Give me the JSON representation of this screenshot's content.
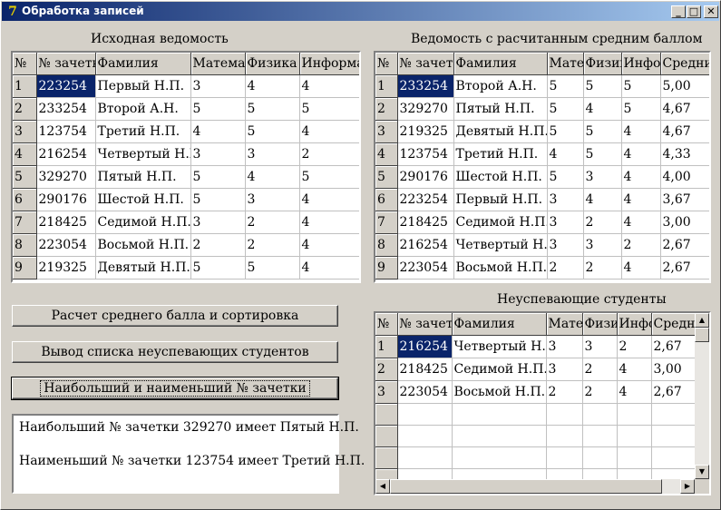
{
  "window": {
    "title": "Обработка записей",
    "minimize_glyph": "_",
    "maximize_glyph": "□",
    "close_glyph": "✕"
  },
  "left_grid": {
    "caption": "Исходная ведомость",
    "columns": [
      "№",
      "№ зачетки",
      "Фамилия",
      "Математика",
      "Физика",
      "Информатика"
    ],
    "rows": [
      [
        "1",
        "223254",
        "Первый Н.П.",
        "3",
        "4",
        "4"
      ],
      [
        "2",
        "233254",
        "Второй А.Н.",
        "5",
        "5",
        "5"
      ],
      [
        "3",
        "123754",
        "Третий Н.П.",
        "4",
        "5",
        "4"
      ],
      [
        "4",
        "216254",
        "Четвертый Н.П.",
        "3",
        "3",
        "2"
      ],
      [
        "5",
        "329270",
        "Пятый Н.П.",
        "5",
        "4",
        "5"
      ],
      [
        "6",
        "290176",
        "Шестой Н.П.",
        "5",
        "3",
        "4"
      ],
      [
        "7",
        "218425",
        "Седимой Н.П.",
        "3",
        "2",
        "4"
      ],
      [
        "8",
        "223054",
        "Восьмой Н.П.",
        "2",
        "2",
        "4"
      ],
      [
        "9",
        "219325",
        "Девятый Н.П.",
        "5",
        "5",
        "4"
      ]
    ]
  },
  "right_grid": {
    "caption": "Ведомость с расчитанным средним баллом",
    "columns": [
      "№",
      "№ зачетки",
      "Фамилия",
      "Математика",
      "Физика",
      "Информатика",
      "Средний балл"
    ],
    "rows": [
      [
        "1",
        "233254",
        "Второй А.Н.",
        "5",
        "5",
        "5",
        "5,00"
      ],
      [
        "2",
        "329270",
        "Пятый Н.П.",
        "5",
        "4",
        "5",
        "4,67"
      ],
      [
        "3",
        "219325",
        "Девятый Н.П.",
        "5",
        "5",
        "4",
        "4,67"
      ],
      [
        "4",
        "123754",
        "Третий Н.П.",
        "4",
        "5",
        "4",
        "4,33"
      ],
      [
        "5",
        "290176",
        "Шестой Н.П.",
        "5",
        "3",
        "4",
        "4,00"
      ],
      [
        "6",
        "223254",
        "Первый Н.П.",
        "3",
        "4",
        "4",
        "3,67"
      ],
      [
        "7",
        "218425",
        "Седимой Н.П.",
        "3",
        "2",
        "4",
        "3,00"
      ],
      [
        "8",
        "216254",
        "Четвертый Н.П.",
        "3",
        "3",
        "2",
        "2,67"
      ],
      [
        "9",
        "223054",
        "Восьмой Н.П.",
        "2",
        "2",
        "4",
        "2,67"
      ]
    ]
  },
  "fail_grid": {
    "caption": "Неуспевающие студенты",
    "columns": [
      "№",
      "№ зачетки",
      "Фамилия",
      "Математика",
      "Физика",
      "Информатика",
      "Средний балл"
    ],
    "rows": [
      [
        "1",
        "216254",
        "Четвертый Н.П.",
        "3",
        "3",
        "2",
        "2,67"
      ],
      [
        "2",
        "218425",
        "Седимой Н.П.",
        "3",
        "2",
        "4",
        "3,00"
      ],
      [
        "3",
        "223054",
        "Восьмой Н.П.",
        "2",
        "2",
        "4",
        "2,67"
      ]
    ]
  },
  "buttons": {
    "calc_sort": "Расчет среднего балла и сортировка",
    "list_failing": "Вывод списка неуспевающих студентов",
    "max_min": "Наибольший и наименьший № зачетки"
  },
  "memo": {
    "line1": "Наибольший № зачетки 329270 имеет Пятый Н.П.",
    "line2": "Наименьший № зачетки 123754 имеет Третий Н.П."
  },
  "scroll_glyphs": {
    "up": "▲",
    "down": "▼",
    "left": "◀",
    "right": "▶"
  }
}
